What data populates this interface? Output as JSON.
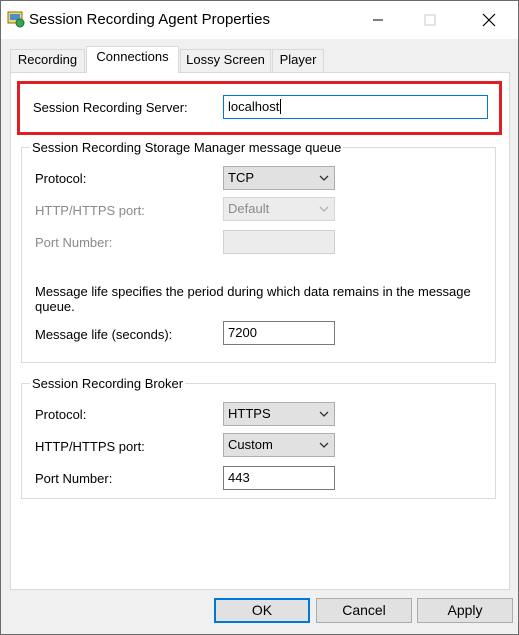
{
  "window": {
    "title": "Session Recording Agent Properties",
    "minimize_icon": "minimize-icon",
    "maximize_icon": "maximize-icon",
    "close_icon": "close-icon"
  },
  "tabs": [
    {
      "label": "Recording",
      "active": false
    },
    {
      "label": "Connections",
      "active": true
    },
    {
      "label": "Lossy Screen",
      "active": false
    },
    {
      "label": "Player",
      "active": false
    }
  ],
  "server": {
    "label": "Session Recording Server:",
    "value": "localhost"
  },
  "storage_queue": {
    "title": "Session Recording Storage Manager message queue",
    "protocol_label": "Protocol:",
    "protocol_value": "TCP",
    "port_type_label": "HTTP/HTTPS port:",
    "port_type_value": "Default",
    "port_number_label": "Port Number:",
    "port_number_value": "",
    "description": "Message life specifies the period during which data remains in the message queue.",
    "life_label": "Message life (seconds):",
    "life_value": "7200"
  },
  "broker": {
    "title": "Session Recording Broker",
    "protocol_label": "Protocol:",
    "protocol_value": "HTTPS",
    "port_type_label": "HTTP/HTTPS port:",
    "port_type_value": "Custom",
    "port_number_label": "Port Number:",
    "port_number_value": "443"
  },
  "buttons": {
    "ok": "OK",
    "cancel": "Cancel",
    "apply": "Apply"
  },
  "colors": {
    "highlight": "#e01e24",
    "focus": "#0078d7"
  }
}
